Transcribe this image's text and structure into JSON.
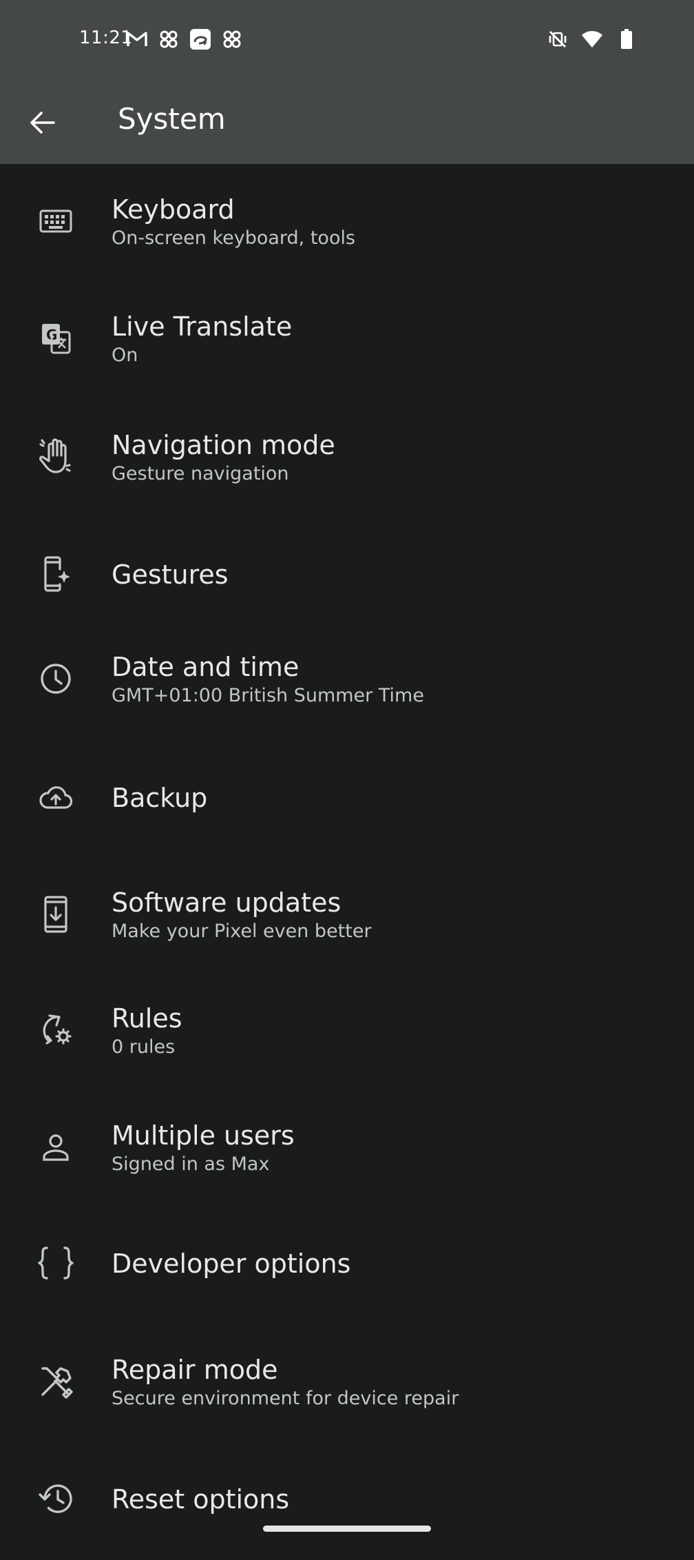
{
  "status_bar": {
    "time": "11:21",
    "left_icons": [
      "gmail-icon",
      "pinwheel-icon",
      "disney-plus-icon",
      "pinwheel-icon"
    ],
    "right_icons": [
      "vibrate-off-icon",
      "wifi-icon",
      "battery-icon"
    ]
  },
  "app_bar": {
    "title": "System",
    "back_icon": "arrow-back-icon"
  },
  "items": [
    {
      "id": "keyboard",
      "label": "Keyboard",
      "sub": "On-screen keyboard, tools",
      "icon": "keyboard-icon"
    },
    {
      "id": "live-translate",
      "label": "Live Translate",
      "sub": "On",
      "icon": "translate-icon"
    },
    {
      "id": "navigation-mode",
      "label": "Navigation mode",
      "sub": "Gesture navigation",
      "icon": "gesture-hand-icon"
    },
    {
      "id": "gestures",
      "label": "Gestures",
      "sub": "",
      "icon": "phone-sparkle-icon"
    },
    {
      "id": "date-and-time",
      "label": "Date and time",
      "sub": "GMT+01:00 British Summer Time",
      "icon": "clock-icon"
    },
    {
      "id": "backup",
      "label": "Backup",
      "sub": "",
      "icon": "cloud-upload-icon"
    },
    {
      "id": "software-updates",
      "label": "Software updates",
      "sub": "Make your Pixel even better",
      "icon": "system-update-icon"
    },
    {
      "id": "rules",
      "label": "Rules",
      "sub": "0 rules",
      "icon": "rules-icon"
    },
    {
      "id": "multiple-users",
      "label": "Multiple users",
      "sub": "Signed in as Max",
      "icon": "person-icon"
    },
    {
      "id": "developer-options",
      "label": "Developer options",
      "sub": "",
      "icon": "braces-icon"
    },
    {
      "id": "repair-mode",
      "label": "Repair mode",
      "sub": "Secure environment for device repair",
      "icon": "tools-icon"
    },
    {
      "id": "reset-options",
      "label": "Reset options",
      "sub": "",
      "icon": "history-icon"
    }
  ]
}
